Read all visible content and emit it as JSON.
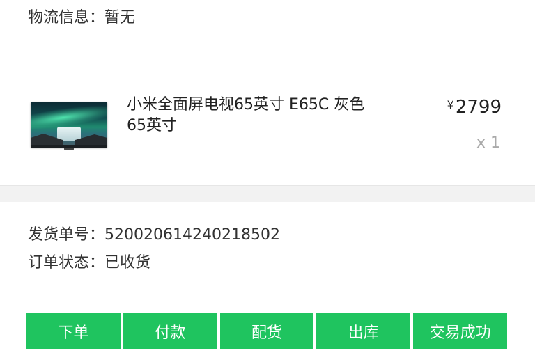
{
  "logistics": {
    "label": "物流信息：",
    "value": "暂无"
  },
  "product": {
    "image_icon": "tv-product-image",
    "name_line1": "小米全面屏电视65英寸 E65C 灰色",
    "name_line2": "65英寸",
    "currency": "¥",
    "price": "2799",
    "quantity": "x 1"
  },
  "shipping": {
    "number_label": "发货单号：",
    "number_value": "520020614240218502",
    "status_label": "订单状态：",
    "status_value": "已收货"
  },
  "steps": [
    {
      "label": "下单"
    },
    {
      "label": "付款"
    },
    {
      "label": "配货"
    },
    {
      "label": "出库"
    },
    {
      "label": "交易成功"
    }
  ],
  "colors": {
    "step_green": "#1fc45f",
    "divider_gray": "#f2f2f2",
    "muted_text": "#aaaaaa"
  }
}
